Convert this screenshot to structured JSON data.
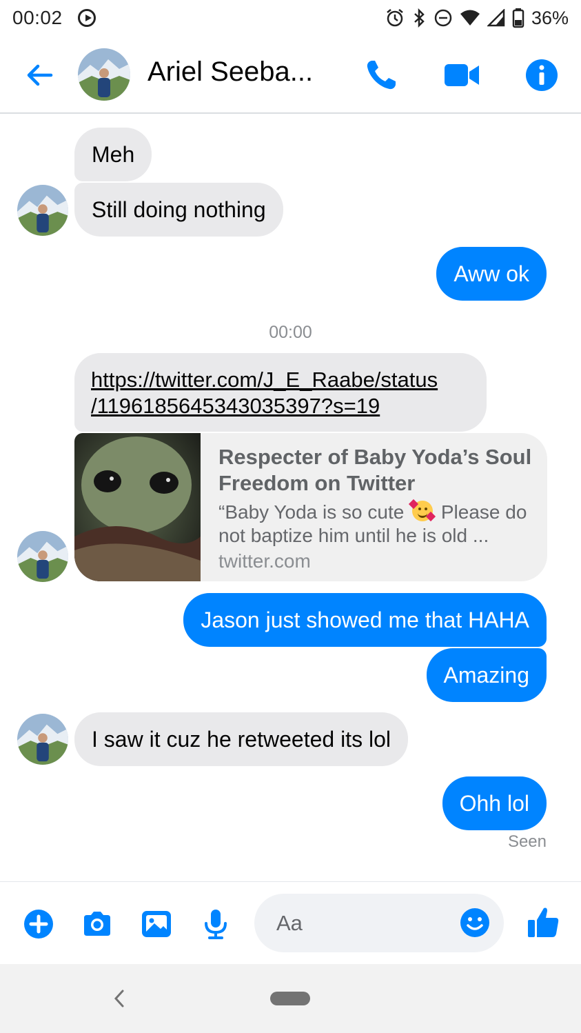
{
  "status_bar": {
    "time": "00:02",
    "battery_percent": "36%",
    "icons": [
      "play-icon",
      "alarm-icon",
      "bluetooth-icon",
      "do-not-disturb-icon",
      "wifi-icon",
      "signal-icon",
      "battery-icon"
    ]
  },
  "header": {
    "contact_name": "Ariel Seeba...",
    "icons": [
      "back-arrow-icon",
      "phone-icon",
      "video-icon",
      "info-icon"
    ]
  },
  "colors": {
    "accent": "#0084ff",
    "incoming_bubble": "#e9e9eb",
    "link_card_bg": "#f0f0f0"
  },
  "messages": [
    {
      "direction": "in",
      "text": "Meh"
    },
    {
      "direction": "in",
      "text": "Still doing nothing"
    },
    {
      "direction": "out",
      "text": "Aww ok"
    },
    {
      "type": "timestamp",
      "text": "00:00"
    },
    {
      "direction": "in",
      "text": "https://twitter.com/J_E_Raabe/status/1196185645343035397?s=19"
    },
    {
      "direction": "in",
      "type": "link_preview",
      "title": "Respecter of Baby Yoda’s Soul Freedom on Twitter",
      "desc_before": "“Baby Yoda is so cute",
      "desc_after": "Please do not baptize him until he is old ...",
      "domain": "twitter.com"
    },
    {
      "direction": "out",
      "text": "Jason just showed me that HAHA"
    },
    {
      "direction": "out",
      "text": "Amazing"
    },
    {
      "direction": "in",
      "text": "I saw it cuz he retweeted its lol"
    },
    {
      "direction": "out",
      "text": "Ohh lol"
    }
  ],
  "link_lines": [
    "https://twitter.com/J_E_Raabe/status",
    "/1196185645343035397?s=19"
  ],
  "seen_label": "Seen",
  "composer": {
    "placeholder": "Aa",
    "icons": [
      "plus-icon",
      "camera-icon",
      "gallery-icon",
      "microphone-icon",
      "emoji-icon",
      "thumbs-up-icon"
    ]
  }
}
